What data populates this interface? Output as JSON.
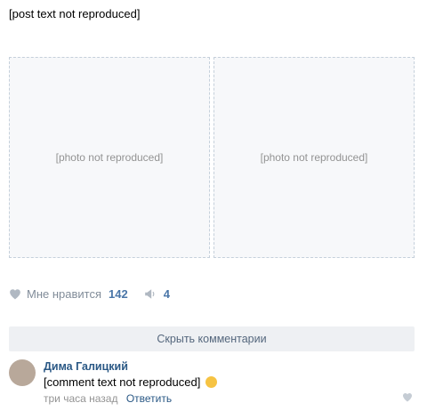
{
  "post": {
    "line1": "[post text not reproduced]",
    "line2": ""
  },
  "photos": {
    "left_label": "[photo not reproduced]",
    "right_label": "[photo not reproduced]"
  },
  "actions": {
    "like_label": "Мне нравится",
    "like_count": "142",
    "share_count": "4"
  },
  "comments_toggle": {
    "label": "Скрыть комментарии"
  },
  "comment": {
    "author": "Дима Галицкий",
    "text": "[comment text not reproduced]",
    "time": "три часа назад",
    "reply_label": "Ответить"
  }
}
